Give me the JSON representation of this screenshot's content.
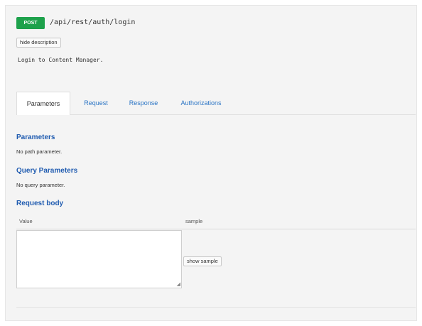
{
  "endpoint": {
    "method": "POST",
    "path": "/api/rest/auth/login",
    "hide_description_label": "hide description",
    "description": "Login to Content Manager."
  },
  "tabs": [
    {
      "label": "Parameters",
      "active": true
    },
    {
      "label": "Request",
      "active": false
    },
    {
      "label": "Response",
      "active": false
    },
    {
      "label": "Authorizations",
      "active": false
    }
  ],
  "parameters": {
    "path_title": "Parameters",
    "path_text": "No path parameter.",
    "query_title": "Query Parameters",
    "query_text": "No query parameter.",
    "body_title": "Request body",
    "value_col": "Value",
    "sample_col": "sample",
    "textarea_value": "",
    "show_sample_label": "show sample"
  },
  "colors": {
    "method_post": "#1da14b",
    "link": "#2a74c4",
    "section_title": "#1f5bb0"
  }
}
